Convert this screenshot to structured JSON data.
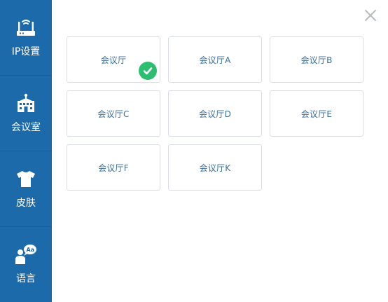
{
  "sidebar": {
    "items": [
      {
        "label": "IP设置",
        "icon": "router-icon"
      },
      {
        "label": "会议室",
        "icon": "building-icon"
      },
      {
        "label": "皮肤",
        "icon": "tshirt-icon"
      },
      {
        "label": "语言",
        "icon": "language-icon"
      }
    ]
  },
  "rooms": [
    {
      "label": "会议厅",
      "selected": true
    },
    {
      "label": "会议厅A",
      "selected": false
    },
    {
      "label": "会议厅B",
      "selected": false
    },
    {
      "label": "会议厅C",
      "selected": false
    },
    {
      "label": "会议厅D",
      "selected": false
    },
    {
      "label": "会议厅E",
      "selected": false
    },
    {
      "label": "会议厅F",
      "selected": false
    },
    {
      "label": "会议厅K",
      "selected": false
    }
  ],
  "colors": {
    "sidebar_bg": "#1c6aa9",
    "accent_text": "#3a6f9c",
    "selected_check": "#2dbf70",
    "card_border": "#d9dde1"
  }
}
